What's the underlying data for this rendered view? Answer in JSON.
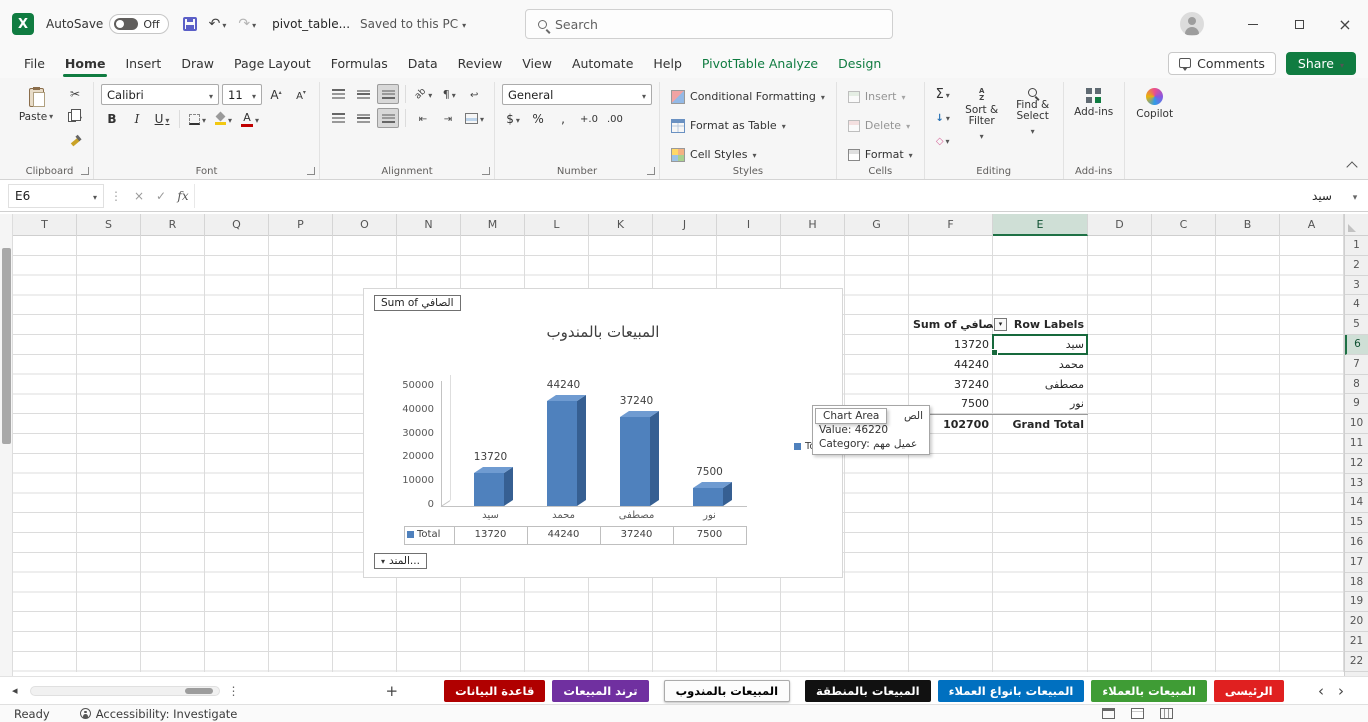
{
  "titlebar": {
    "autosave_label": "AutoSave",
    "autosave_state": "Off",
    "filename": "pivot_table...",
    "saved_status": "Saved to this PC",
    "search_placeholder": "Search"
  },
  "buttons": {
    "comments": "Comments",
    "share": "Share"
  },
  "ribbon_tabs": [
    "File",
    "Home",
    "Insert",
    "Draw",
    "Page Layout",
    "Formulas",
    "Data",
    "Review",
    "View",
    "Automate",
    "Help",
    "PivotTable Analyze",
    "Design"
  ],
  "active_tab": "Home",
  "contextual_tabs": [
    "PivotTable Analyze",
    "Design"
  ],
  "ribbon": {
    "clipboard": {
      "label": "Clipboard",
      "paste": "Paste"
    },
    "font": {
      "label": "Font",
      "font_name": "Calibri",
      "font_size": "11",
      "bold": "B",
      "italic": "I",
      "underline": "U"
    },
    "alignment": {
      "label": "Alignment"
    },
    "number": {
      "label": "Number",
      "format": "General",
      "currency": "$",
      "percent": "%",
      "comma": ",",
      "inc_decimal": "+.0",
      "dec_decimal": ".00"
    },
    "styles": {
      "label": "Styles",
      "conditional_formatting": "Conditional Formatting",
      "format_as_table": "Format as Table",
      "cell_styles": "Cell Styles"
    },
    "cells": {
      "label": "Cells",
      "insert": "Insert",
      "delete": "Delete",
      "format": "Format"
    },
    "editing": {
      "label": "Editing",
      "autosum": "Σ",
      "sort_filter": "Sort & Filter",
      "find_select": "Find & Select"
    },
    "addins": {
      "label": "Add-ins"
    },
    "copilot": {
      "label": "Copilot"
    }
  },
  "formula_bar": {
    "name_box": "E6",
    "fx": "fx",
    "content": "سيد"
  },
  "grid": {
    "columns": [
      "T",
      "S",
      "R",
      "Q",
      "P",
      "O",
      "N",
      "M",
      "L",
      "K",
      "J",
      "I",
      "H",
      "G",
      "F",
      "E",
      "D",
      "C",
      "B",
      "A"
    ],
    "row_count": 22,
    "selected_cell": "E6",
    "selected_column": "E",
    "selected_row": 6
  },
  "pivot": {
    "value_header": "Sum of الصافي",
    "row_header": "Row Labels",
    "rows": [
      {
        "label": "سيد",
        "value": "13720"
      },
      {
        "label": "محمد",
        "value": "44240"
      },
      {
        "label": "مصطفى",
        "value": "37240"
      },
      {
        "label": "نور",
        "value": "7500"
      }
    ],
    "grand_total_label": "Grand Total",
    "grand_total_value": "102700"
  },
  "chart_data": {
    "type": "bar",
    "title": "المبيعات بالمندوب",
    "categories": [
      "سيد",
      "محمد",
      "مصطفى",
      "نور"
    ],
    "series": [
      {
        "name": "Total",
        "values": [
          13720,
          44240,
          37240,
          7500
        ]
      }
    ],
    "data_labels": [
      "13720",
      "44240",
      "37240",
      "7500"
    ],
    "ylim": [
      0,
      50000
    ],
    "yticks": [
      0,
      10000,
      20000,
      30000,
      40000,
      50000
    ],
    "legend": "Total",
    "legend_position": "right",
    "grid": false,
    "bar_color": "#4f81bd",
    "field_buttons": {
      "value": "Sum of الصافي",
      "axis": "المند..."
    },
    "table_values": [
      "13720",
      "44240",
      "37240",
      "7500"
    ]
  },
  "tooltip": {
    "chart_area": "Chart Area",
    "series_fragment": "الص",
    "value_line": "Value: 46220",
    "category_line": "Category: عميل مهم"
  },
  "sheet_tabs": [
    {
      "label": "قاعدة البيانات",
      "color": "#B00000",
      "active": false
    },
    {
      "label": "ترند المبيعات",
      "color": "#7030A0",
      "active": false
    },
    {
      "label": "المبيعات بالمندوب",
      "color": "",
      "active": true
    },
    {
      "label": "المبيعات بالمنطقة",
      "color": "#111111",
      "active": false
    },
    {
      "label": "المبيعات بانواع العملاء",
      "color": "#0070C0",
      "active": false
    },
    {
      "label": "المبيعات بالعملاء",
      "color": "#3F9C35",
      "active": false
    },
    {
      "label": "الرئيسى",
      "color": "#E02020",
      "active": false
    }
  ],
  "status_bar": {
    "ready": "Ready",
    "accessibility": "Accessibility: Investigate"
  }
}
